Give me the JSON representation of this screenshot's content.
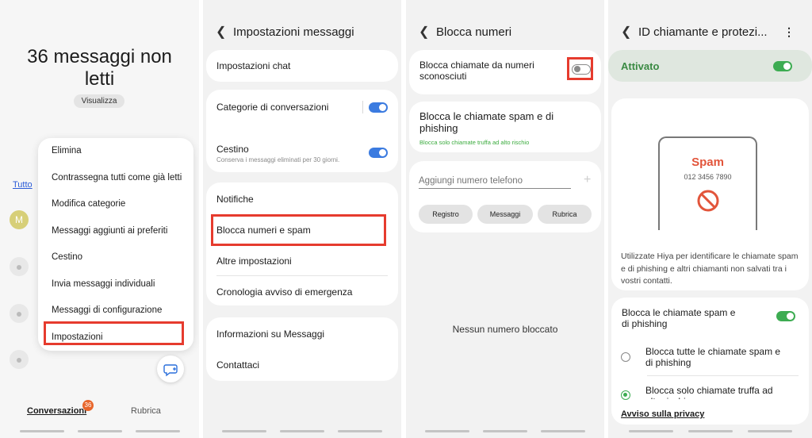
{
  "panel1": {
    "title": "36 messaggi non letti",
    "view_button": "Visualizza",
    "filter_all": "Tutto",
    "avatar_letter": "M",
    "menu": [
      "Elimina",
      "Contrassegna tutti come già letti",
      "Modifica categorie",
      "Messaggi aggiunti ai preferiti",
      "Cestino",
      "Invia messaggi individuali",
      "Messaggi di configurazione",
      "Impostazioni"
    ],
    "tab_conversations": "Conversazioni",
    "tab_badge": "36",
    "tab_contacts": "Rubrica"
  },
  "panel2": {
    "title": "Impostazioni messaggi",
    "chat": "Impostazioni chat",
    "categories": "Categorie di conversazioni",
    "trash": "Cestino",
    "trash_sub": "Conserva i messaggi eliminati per 30 giorni.",
    "notifications": "Notifiche",
    "block": "Blocca numeri e spam",
    "other": "Altre impostazioni",
    "emergency": "Cronologia avviso di emergenza",
    "info": "Informazioni su Messaggi",
    "contact": "Contattaci"
  },
  "panel3": {
    "title": "Blocca numeri",
    "unknown": "Blocca chiamate da numeri sconosciuti",
    "spam_title": "Blocca le chiamate spam e di phishing",
    "spam_sub": "Blocca solo chiamate truffa ad alto rischio",
    "add_placeholder": "Aggiungi numero telefono",
    "chips": [
      "Registro",
      "Messaggi",
      "Rubrica"
    ],
    "empty": "Nessun numero bloccato"
  },
  "panel4": {
    "title": "ID chiamante e protezi...",
    "enabled": "Attivato",
    "spam_label": "Spam",
    "spam_number": "012 3456 7890",
    "description": "Utilizzate Hiya per identificare le chiamate spam e di phishing e altri chiamanti non salvati tra i vostri contatti.",
    "block_spam": "Blocca le chiamate spam e di phishing",
    "option_all": "Blocca tutte le chiamate spam e di phishing",
    "option_risky": "Blocca solo chiamate truffa ad alto rischio",
    "privacy": "Avviso sulla privacy"
  },
  "colors": {
    "highlight": "#e63b2e",
    "toggle_blue": "#3b7be0",
    "toggle_green": "#3dac52",
    "spam_red": "#e2553b"
  }
}
